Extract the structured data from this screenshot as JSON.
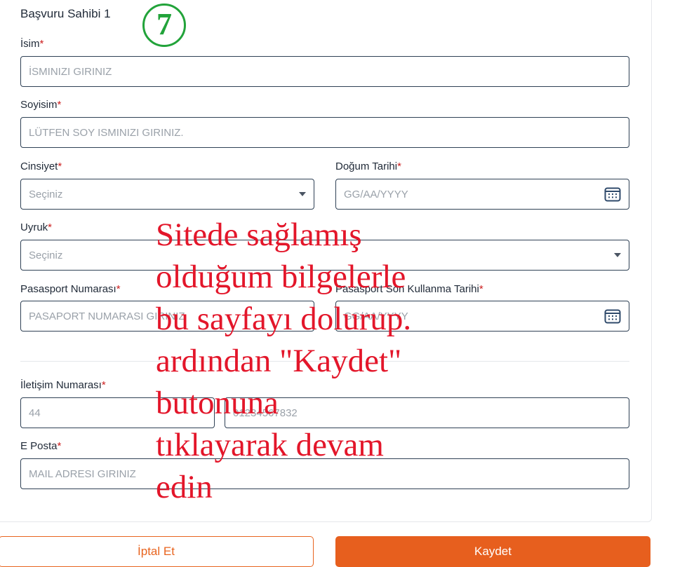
{
  "form": {
    "section_title": "Başvuru Sahibi 1",
    "step_number": "7",
    "required_mark": "*",
    "first_name": {
      "label": "İsim",
      "placeholder": "İSMINIZI GIRINIZ"
    },
    "last_name": {
      "label": "Soyisim",
      "placeholder": "LÜTFEN SOY ISMINIZI GIRINIZ."
    },
    "gender": {
      "label": "Cinsiyet",
      "placeholder": "Seçiniz"
    },
    "birth_date": {
      "label": "Doğum Tarihi",
      "placeholder": "GG/AA/YYYY"
    },
    "nationality": {
      "label": "Uyruk",
      "placeholder": "Seçiniz"
    },
    "passport_number": {
      "label": "Pasasport Numarası",
      "placeholder": "PASAPORT NUMARASI GIRINIZ"
    },
    "passport_expiry": {
      "label": "Pasasport Son Kullanma Tarihi",
      "placeholder": "GG/AA/YYYY"
    },
    "phone": {
      "label": "İletişim Numarası",
      "country_code_placeholder": "44",
      "number_placeholder": "01234567832"
    },
    "email": {
      "label": "E Posta",
      "placeholder": "MAIL ADRESI GIRINIZ"
    }
  },
  "actions": {
    "cancel_label": "İptal Et",
    "save_label": "Kaydet"
  },
  "overlay_lines": [
    "Sitede sağlamış",
    "olduğum bilgelerle",
    "bu sayfayı dolurup.",
    "ardından \"Kaydet\"",
    "butonuna",
    "tıklayarak devam",
    "edin"
  ],
  "colors": {
    "accent": "#e75f1e",
    "required": "#cc1f1f",
    "overlay_text": "#e3162a",
    "step_badge": "#22a33a",
    "field_border": "#2f4155"
  },
  "icons": {
    "select": "chevron-down-icon",
    "date": "calendar-icon"
  }
}
